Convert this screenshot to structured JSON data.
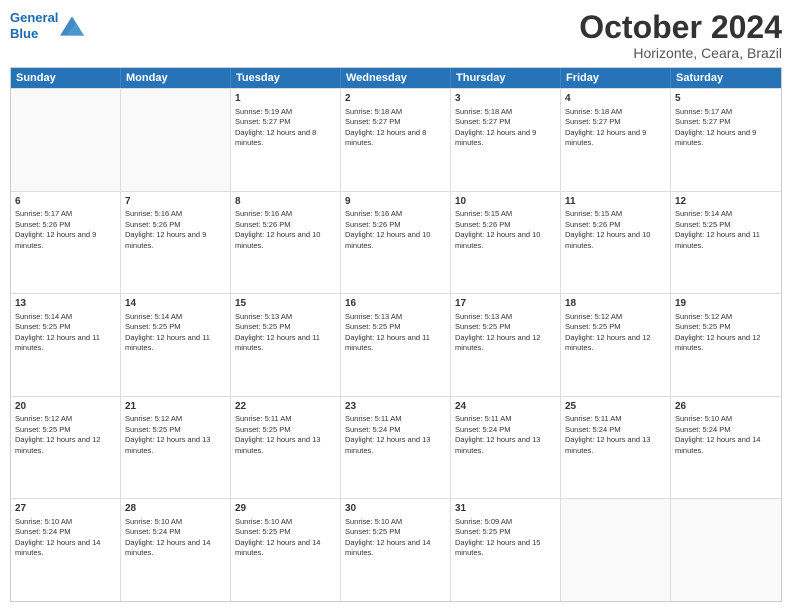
{
  "logo": {
    "line1": "General",
    "line2": "Blue"
  },
  "title": "October 2024",
  "subtitle": "Horizonte, Ceara, Brazil",
  "days_of_week": [
    "Sunday",
    "Monday",
    "Tuesday",
    "Wednesday",
    "Thursday",
    "Friday",
    "Saturday"
  ],
  "weeks": [
    [
      {
        "day": "",
        "empty": true
      },
      {
        "day": "",
        "empty": true
      },
      {
        "day": "1",
        "sunrise": "5:19 AM",
        "sunset": "5:27 PM",
        "daylight": "12 hours and 8 minutes."
      },
      {
        "day": "2",
        "sunrise": "5:18 AM",
        "sunset": "5:27 PM",
        "daylight": "12 hours and 8 minutes."
      },
      {
        "day": "3",
        "sunrise": "5:18 AM",
        "sunset": "5:27 PM",
        "daylight": "12 hours and 9 minutes."
      },
      {
        "day": "4",
        "sunrise": "5:18 AM",
        "sunset": "5:27 PM",
        "daylight": "12 hours and 9 minutes."
      },
      {
        "day": "5",
        "sunrise": "5:17 AM",
        "sunset": "5:27 PM",
        "daylight": "12 hours and 9 minutes."
      }
    ],
    [
      {
        "day": "6",
        "sunrise": "5:17 AM",
        "sunset": "5:26 PM",
        "daylight": "12 hours and 9 minutes."
      },
      {
        "day": "7",
        "sunrise": "5:16 AM",
        "sunset": "5:26 PM",
        "daylight": "12 hours and 9 minutes."
      },
      {
        "day": "8",
        "sunrise": "5:16 AM",
        "sunset": "5:26 PM",
        "daylight": "12 hours and 10 minutes."
      },
      {
        "day": "9",
        "sunrise": "5:16 AM",
        "sunset": "5:26 PM",
        "daylight": "12 hours and 10 minutes."
      },
      {
        "day": "10",
        "sunrise": "5:15 AM",
        "sunset": "5:26 PM",
        "daylight": "12 hours and 10 minutes."
      },
      {
        "day": "11",
        "sunrise": "5:15 AM",
        "sunset": "5:26 PM",
        "daylight": "12 hours and 10 minutes."
      },
      {
        "day": "12",
        "sunrise": "5:14 AM",
        "sunset": "5:25 PM",
        "daylight": "12 hours and 11 minutes."
      }
    ],
    [
      {
        "day": "13",
        "sunrise": "5:14 AM",
        "sunset": "5:25 PM",
        "daylight": "12 hours and 11 minutes."
      },
      {
        "day": "14",
        "sunrise": "5:14 AM",
        "sunset": "5:25 PM",
        "daylight": "12 hours and 11 minutes."
      },
      {
        "day": "15",
        "sunrise": "5:13 AM",
        "sunset": "5:25 PM",
        "daylight": "12 hours and 11 minutes."
      },
      {
        "day": "16",
        "sunrise": "5:13 AM",
        "sunset": "5:25 PM",
        "daylight": "12 hours and 11 minutes."
      },
      {
        "day": "17",
        "sunrise": "5:13 AM",
        "sunset": "5:25 PM",
        "daylight": "12 hours and 12 minutes."
      },
      {
        "day": "18",
        "sunrise": "5:12 AM",
        "sunset": "5:25 PM",
        "daylight": "12 hours and 12 minutes."
      },
      {
        "day": "19",
        "sunrise": "5:12 AM",
        "sunset": "5:25 PM",
        "daylight": "12 hours and 12 minutes."
      }
    ],
    [
      {
        "day": "20",
        "sunrise": "5:12 AM",
        "sunset": "5:25 PM",
        "daylight": "12 hours and 12 minutes."
      },
      {
        "day": "21",
        "sunrise": "5:12 AM",
        "sunset": "5:25 PM",
        "daylight": "12 hours and 13 minutes."
      },
      {
        "day": "22",
        "sunrise": "5:11 AM",
        "sunset": "5:25 PM",
        "daylight": "12 hours and 13 minutes."
      },
      {
        "day": "23",
        "sunrise": "5:11 AM",
        "sunset": "5:24 PM",
        "daylight": "12 hours and 13 minutes."
      },
      {
        "day": "24",
        "sunrise": "5:11 AM",
        "sunset": "5:24 PM",
        "daylight": "12 hours and 13 minutes."
      },
      {
        "day": "25",
        "sunrise": "5:11 AM",
        "sunset": "5:24 PM",
        "daylight": "12 hours and 13 minutes."
      },
      {
        "day": "26",
        "sunrise": "5:10 AM",
        "sunset": "5:24 PM",
        "daylight": "12 hours and 14 minutes."
      }
    ],
    [
      {
        "day": "27",
        "sunrise": "5:10 AM",
        "sunset": "5:24 PM",
        "daylight": "12 hours and 14 minutes."
      },
      {
        "day": "28",
        "sunrise": "5:10 AM",
        "sunset": "5:24 PM",
        "daylight": "12 hours and 14 minutes."
      },
      {
        "day": "29",
        "sunrise": "5:10 AM",
        "sunset": "5:25 PM",
        "daylight": "12 hours and 14 minutes."
      },
      {
        "day": "30",
        "sunrise": "5:10 AM",
        "sunset": "5:25 PM",
        "daylight": "12 hours and 14 minutes."
      },
      {
        "day": "31",
        "sunrise": "5:09 AM",
        "sunset": "5:25 PM",
        "daylight": "12 hours and 15 minutes."
      },
      {
        "day": "",
        "empty": true
      },
      {
        "day": "",
        "empty": true
      }
    ]
  ]
}
